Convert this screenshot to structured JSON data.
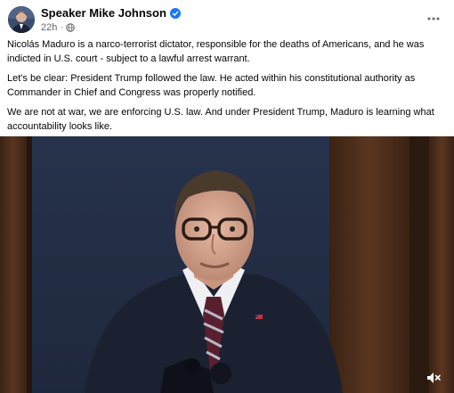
{
  "post": {
    "author": "Speaker Mike Johnson",
    "time": "22h",
    "separator": "·",
    "paragraphs": [
      "Nicolás Maduro is a narco-terrorist dictator, responsible for the deaths of Americans, and he was indicted in U.S. court - subject to a lawful arrest warrant.",
      "Let's be clear: President Trump followed the law. He acted within his constitutional authority as Commander in Chief and Congress was properly notified.",
      "We are not at war, we are enforcing U.S. law. And under President Trump, Maduro is learning what accountability looks like."
    ]
  },
  "icons": {
    "verified": "verified-badge-icon",
    "globe": "globe-icon",
    "more": "more-options-icon",
    "sound": "muted-speaker-icon"
  },
  "colors": {
    "verified_blue": "#1877f2",
    "meta_gray": "#65676b",
    "text": "#050505"
  }
}
